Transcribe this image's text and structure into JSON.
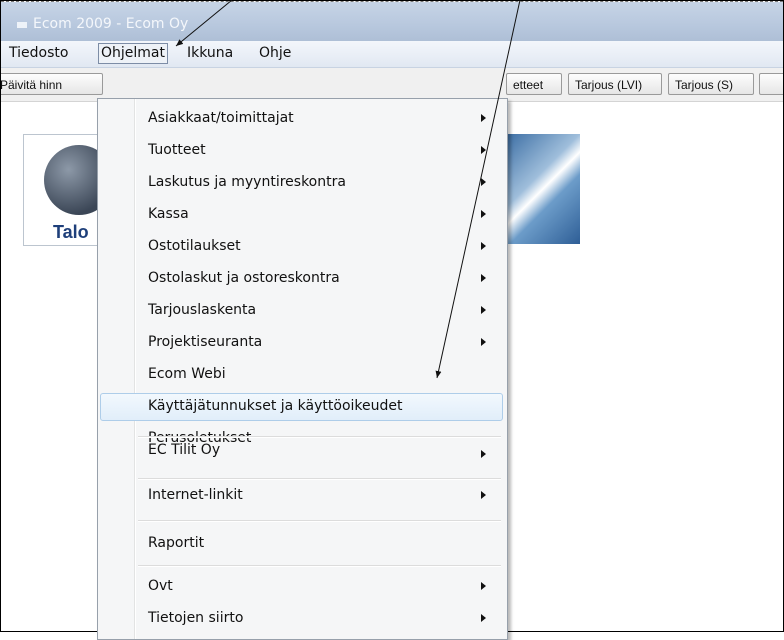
{
  "window": {
    "title": "Ecom 2009 - Ecom Oy"
  },
  "menubar": {
    "items": [
      "Tiedosto",
      "Ohjelmat",
      "Ikkuna",
      "Ohje"
    ]
  },
  "toolbar": {
    "buttons": [
      "Päivitä hinn",
      "etteet",
      "Tarjous (LVI)",
      "Tarjous (S)"
    ]
  },
  "logo": {
    "text": "Talo",
    "icon": "euro-icon"
  },
  "menu": {
    "items": [
      {
        "label": "Asiakkaat/toimittajat",
        "submenu": true
      },
      {
        "label": "Tuotteet",
        "submenu": true
      },
      {
        "label": "Laskutus ja myyntireskontra",
        "submenu": true
      },
      {
        "label": "Kassa",
        "submenu": true
      },
      {
        "label": "Ostotilaukset",
        "submenu": true
      },
      {
        "label": "Ostolaskut ja ostoreskontra",
        "submenu": true
      },
      {
        "label": "Tarjouslaskenta",
        "submenu": true
      },
      {
        "label": "Projektiseuranta",
        "submenu": true
      },
      {
        "label": "Ecom Webi",
        "submenu": false
      },
      {
        "label": "Käyttäjätunnukset ja käyttöoikeudet",
        "submenu": false,
        "highlighted": true
      },
      {
        "label": "Perusoletukset",
        "submenu": false
      },
      {
        "label": "EC Tilit Oy",
        "submenu": true
      },
      {
        "label": "Internet-linkit",
        "submenu": true
      },
      {
        "label": "Raportit",
        "submenu": false
      },
      {
        "label": "Ovt",
        "submenu": true
      },
      {
        "label": "Tietojen siirto",
        "submenu": true
      }
    ]
  },
  "colors": {
    "highlight": "#e1eefa",
    "highlight_border": "#aecde9",
    "titlebar": "#b8c8de"
  }
}
